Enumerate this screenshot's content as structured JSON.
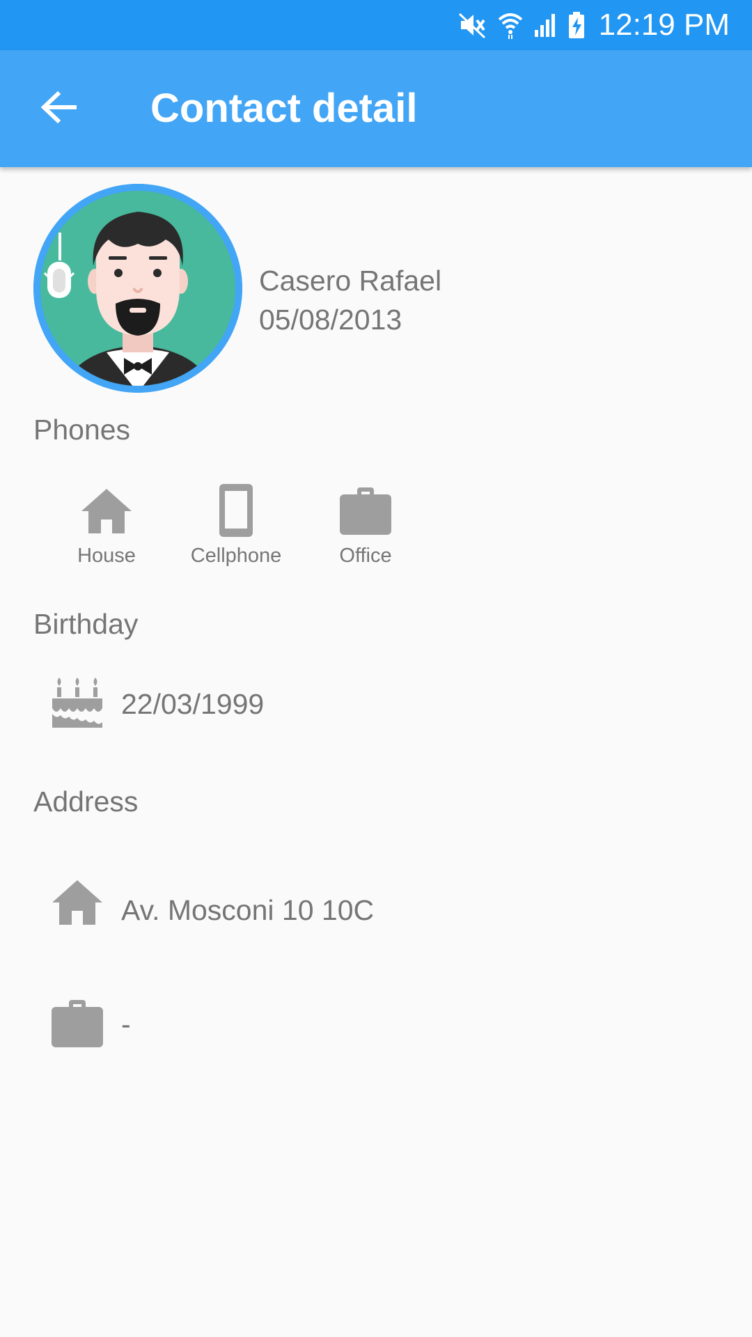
{
  "status_bar": {
    "time": "12:19 PM",
    "icons": [
      "mute-icon",
      "wifi-icon",
      "signal-icon",
      "battery-charging-icon"
    ],
    "background": "#2196f3"
  },
  "app_bar": {
    "title": "Contact detail",
    "back_icon": "arrow-back-icon",
    "background": "#42a5f5"
  },
  "profile": {
    "name": "Casero Rafael",
    "date": "05/08/2013",
    "avatar_icon": "avatar-man-with-goatee"
  },
  "phones": {
    "title": "Phones",
    "items": [
      {
        "label": "House",
        "icon": "home-icon"
      },
      {
        "label": "Cellphone",
        "icon": "smartphone-icon"
      },
      {
        "label": "Office",
        "icon": "briefcase-icon"
      }
    ]
  },
  "birthday": {
    "title": "Birthday",
    "value": "22/03/1999",
    "icon": "cake-icon"
  },
  "address": {
    "title": "Address",
    "home": {
      "value": "Av. Mosconi 10 10C",
      "icon": "home-icon"
    },
    "work": {
      "value": "-",
      "icon": "briefcase-icon"
    }
  },
  "colors": {
    "primary_dark": "#2196f3",
    "primary": "#42a5f5",
    "text_secondary": "#757575",
    "icon_grey": "#9e9e9e",
    "background": "#fafafa"
  }
}
